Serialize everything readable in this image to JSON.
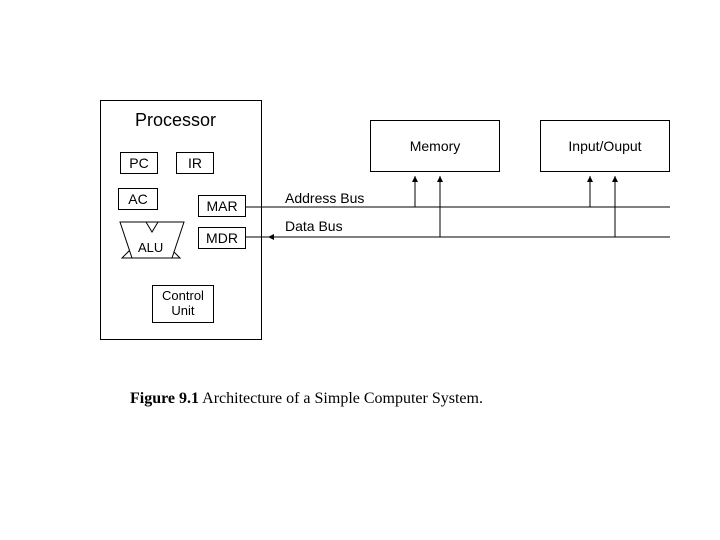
{
  "processor": {
    "title": "Processor",
    "registers": {
      "pc": "PC",
      "ir": "IR",
      "ac": "AC",
      "mar": "MAR",
      "mdr": "MDR"
    },
    "alu": "ALU",
    "control_unit": "Control\nUnit"
  },
  "memory": {
    "label": "Memory"
  },
  "io": {
    "label": "Input/Ouput"
  },
  "buses": {
    "address": "Address Bus",
    "data": "Data Bus"
  },
  "caption": {
    "strong": "Figure 9.1",
    "rest": " Architecture of a Simple Computer System."
  }
}
